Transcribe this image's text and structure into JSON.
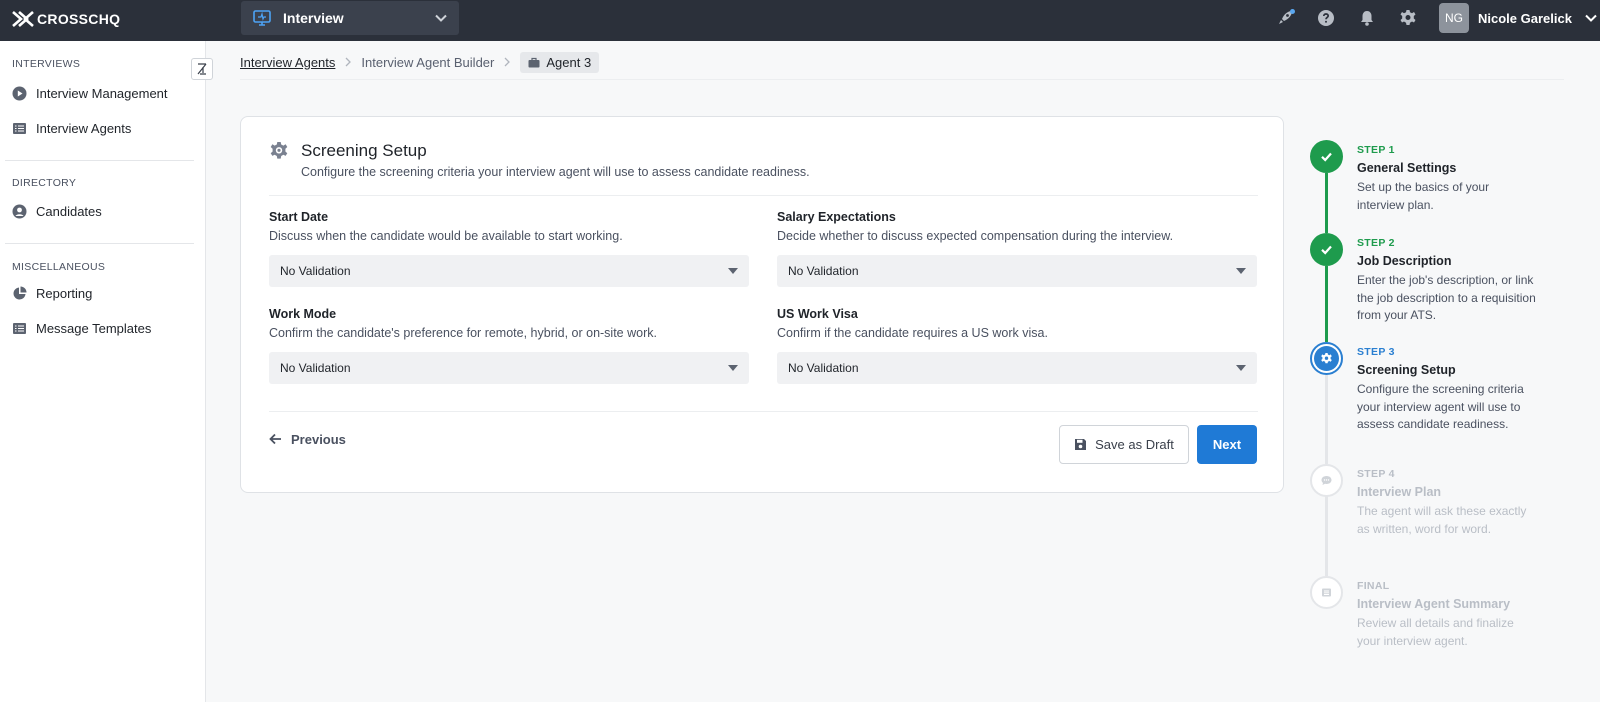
{
  "topbar": {
    "brand": "CROSSCHQ",
    "product": "Interview",
    "user_initials": "NG",
    "user_name": "Nicole Garelick"
  },
  "sidebar": {
    "sections": [
      {
        "title": "INTERVIEWS",
        "items": [
          {
            "label": "Interview Management",
            "icon": "play-circle-icon"
          },
          {
            "label": "Interview Agents",
            "icon": "list-icon"
          }
        ]
      },
      {
        "title": "DIRECTORY",
        "items": [
          {
            "label": "Candidates",
            "icon": "user-circle-icon"
          }
        ]
      },
      {
        "title": "MISCELLANEOUS",
        "items": [
          {
            "label": "Reporting",
            "icon": "pie-chart-icon"
          },
          {
            "label": "Message Templates",
            "icon": "list-icon"
          }
        ]
      }
    ]
  },
  "breadcrumb": {
    "items": [
      "Interview Agents",
      "Interview Agent Builder",
      "Agent 3"
    ]
  },
  "card": {
    "title": "Screening Setup",
    "subtitle": "Configure the screening criteria your interview agent will use to assess candidate readiness.",
    "fields": [
      {
        "label": "Start Date",
        "desc": "Discuss when the candidate would be available to start working.",
        "value": "No Validation"
      },
      {
        "label": "Salary Expectations",
        "desc": "Decide whether to discuss expected compensation during the interview.",
        "value": "No Validation"
      },
      {
        "label": "Work Mode",
        "desc": "Confirm the candidate's preference for remote, hybrid, or on-site work.",
        "value": "No Validation"
      },
      {
        "label": "US Work Visa",
        "desc": "Confirm if the candidate requires a US work visa.",
        "value": "No Validation"
      }
    ],
    "previous_label": "Previous",
    "draft_label": "Save as Draft",
    "next_label": "Next"
  },
  "stepper": {
    "steps": [
      {
        "num": "STEP 1",
        "title": "General Settings",
        "desc": "Set up the basics of your interview plan.",
        "state": "done"
      },
      {
        "num": "STEP 2",
        "title": "Job Description",
        "desc": "Enter the job's description, or link the job description to a requisition from your ATS.",
        "state": "done"
      },
      {
        "num": "STEP 3",
        "title": "Screening Setup",
        "desc": "Configure the screening criteria your interview agent will use to assess candidate readiness.",
        "state": "active"
      },
      {
        "num": "STEP 4",
        "title": "Interview Plan",
        "desc": "The agent will ask these exactly as written, word for word.",
        "state": "todo"
      },
      {
        "num": "FINAL",
        "title": "Interview Agent Summary",
        "desc": "Review all details and finalize your interview agent.",
        "state": "todo"
      }
    ]
  },
  "colors": {
    "topbar": "#2b303a",
    "primary": "#1f7ad6",
    "success": "#1e9b4d"
  }
}
